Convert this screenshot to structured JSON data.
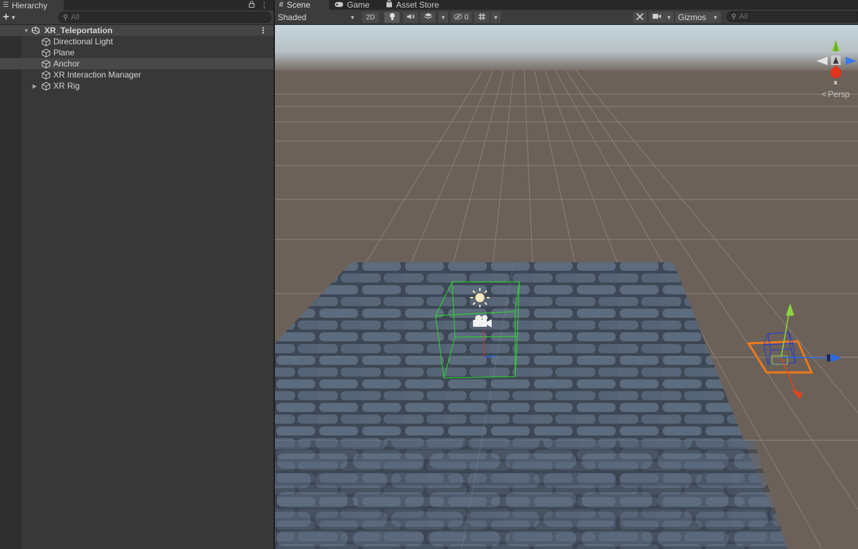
{
  "hierarchy": {
    "tab_label": "Hierarchy",
    "tab_icon": "list-icon",
    "search_placeholder": "All",
    "scene_name": "XR_Teleportation",
    "items": [
      {
        "label": "Directional Light",
        "icon": "gameobject-cube-icon",
        "expandable": false,
        "selected": false
      },
      {
        "label": "Plane",
        "icon": "gameobject-cube-icon",
        "expandable": false,
        "selected": false
      },
      {
        "label": "Anchor",
        "icon": "gameobject-cube-icon",
        "expandable": false,
        "selected": true
      },
      {
        "label": "XR Interaction Manager",
        "icon": "gameobject-cube-icon",
        "expandable": false,
        "selected": false
      },
      {
        "label": "XR Rig",
        "icon": "gameobject-cube-icon",
        "expandable": true,
        "selected": false
      }
    ]
  },
  "scene_tabs": [
    {
      "label": "Scene",
      "icon": "grid-icon",
      "active": true
    },
    {
      "label": "Game",
      "icon": "gamepad-icon",
      "active": false
    },
    {
      "label": "Asset Store",
      "icon": "shopping-bag-icon",
      "active": false
    }
  ],
  "scene_toolbar": {
    "shading_mode": "Shaded",
    "mode_2d": "2D",
    "hidden_count": "0",
    "gizmos_label": "Gizmos",
    "search_placeholder": "All"
  },
  "viewport": {
    "projection": "Persp",
    "axis_label_x": "x",
    "colors": {
      "sky_top": "#c6d6e0",
      "ground": "#6b6158",
      "grid_line": "#8a8178",
      "selection_bounds": "#24e024",
      "selection_outline": "#f07a1a",
      "axis_x": "#e0441c",
      "axis_y": "#8cd43a",
      "axis_z": "#2a6ae8"
    }
  }
}
